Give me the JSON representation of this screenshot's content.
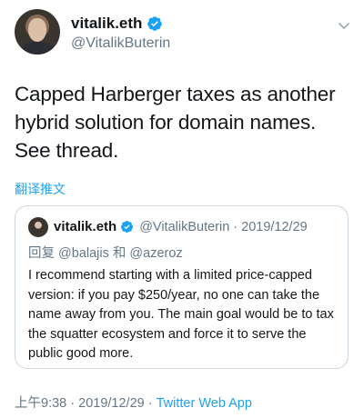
{
  "author": {
    "display_name": "vitalik.eth",
    "handle": "@VitalikButerin",
    "verified_color": "#1da1f2"
  },
  "tweet": {
    "text": "Capped Harberger taxes as another hybrid solution for domain names. See thread.",
    "translate_label": "翻译推文"
  },
  "quoted_tweet": {
    "display_name": "vitalik.eth",
    "handle": "@VitalikButerin",
    "separator": "·",
    "date": "2019/12/29",
    "reply_prefix": "回复",
    "reply_mention_1": "@balajis",
    "reply_conjunction": "和",
    "reply_mention_2": "@azeroz",
    "text": "I recommend starting with a limited price-capped version: if you pay $250/year, no one can take the name away from you. The main goal would be to tax the squatter ecosystem and force it to serve the public good more."
  },
  "footer": {
    "time": "上午9:38",
    "separator_1": "·",
    "date": "2019/12/29",
    "separator_2": "·",
    "source": "Twitter Web App"
  },
  "icons": {
    "verified": "verified-badge-icon",
    "menu": "chevron-down-icon"
  },
  "colors": {
    "accent": "#1da1f2",
    "secondary_text": "#657786",
    "primary_text": "#14171a",
    "border": "#ccd6dd"
  }
}
